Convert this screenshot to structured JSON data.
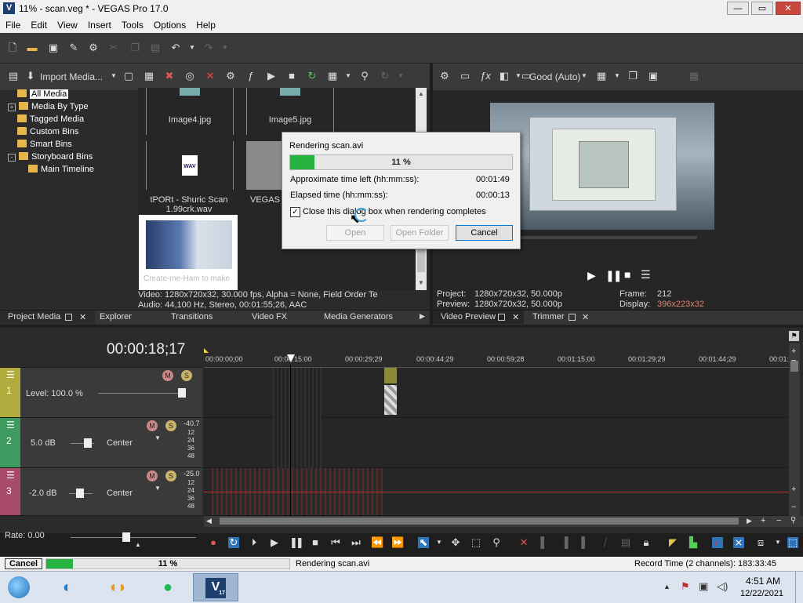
{
  "window": {
    "title": "11% - scan.veg * - VEGAS Pro 17.0",
    "logo": "V",
    "min": "—",
    "max": "▭",
    "close": "✕"
  },
  "menu": [
    "File",
    "Edit",
    "View",
    "Insert",
    "Tools",
    "Options",
    "Help"
  ],
  "media_panel": {
    "import_label": "Import Media...",
    "tree": [
      {
        "label": "All Media",
        "expander": "",
        "selected": true
      },
      {
        "label": "Media By Type",
        "expander": "+"
      },
      {
        "label": "Tagged Media",
        "expander": ""
      },
      {
        "label": "Custom Bins",
        "expander": ""
      },
      {
        "label": "Smart Bins",
        "expander": ""
      },
      {
        "label": "Storyboard Bins",
        "expander": "-"
      },
      {
        "label": "Main Timeline",
        "expander": "",
        "indent": true
      }
    ],
    "thumbs": {
      "image4": "Image4.jpg",
      "image5": "Image5.jpg",
      "wav_line1": "tPORt - Shuric Scan",
      "wav_line2": "1.99crk.wav",
      "wav_icon": "WAV",
      "vegas_s": "VEGAS S",
      "video_caption": "Create-me-Ham to make"
    },
    "info_line1": "Video: 1280x720x32, 30.000 fps, Alpha = None, Field Order Te",
    "info_line2": "Audio: 44,100 Hz, Stereo, 00:01:55;26, AAC"
  },
  "bottom_tabs": {
    "project_media": "Project Media",
    "explorer": "Explorer",
    "transitions": "Transitions",
    "video_fx": "Video FX",
    "media_generators": "Media Generators",
    "video_preview": "Video Preview",
    "trimmer": "Trimmer",
    "close_x": "✕",
    "more": "▶"
  },
  "preview": {
    "quality": "Good (Auto)",
    "project_label": "Project:",
    "project_value": "1280x720x32, 50.000p",
    "preview_label": "Preview:",
    "preview_value": "1280x720x32, 50.000p",
    "frame_label": "Frame:",
    "frame_value": "212",
    "display_label": "Display:",
    "display_value": "396x223x32"
  },
  "dialog": {
    "title": "Rendering scan.avi",
    "progress_pct": 11,
    "progress_label": "11 %",
    "time_left_label": "Approximate time left (hh:mm:ss):",
    "time_left": "00:01:49",
    "elapsed_label": "Elapsed time (hh:mm:ss):",
    "elapsed": "00:00:13",
    "close_checkbox": "Close this dialog box when rendering completes",
    "open": "Open",
    "open_folder": "Open Folder",
    "cancel": "Cancel"
  },
  "timeline": {
    "timecode": "00:00:18;17",
    "ruler": [
      "00:00:00;00",
      "00:00:15:00",
      "00:00:29;29",
      "00:00:44;29",
      "00:00:59;28",
      "00:01:15;00",
      "00:01:29;29",
      "00:01:44;29",
      "00:01:"
    ],
    "tracks": [
      {
        "num": "1",
        "label": "Level: 100.0 %",
        "color": "#b0ad3e"
      },
      {
        "num": "2",
        "label": "5.0 dB",
        "pan": "Center",
        "peak": "-40.7",
        "color": "#3f9a5f"
      },
      {
        "num": "3",
        "label": "-2.0 dB",
        "pan": "Center",
        "peak": "-25.0",
        "color": "#a84a6a"
      }
    ],
    "meter_ticks": [
      "12",
      "24",
      "36",
      "48"
    ],
    "rate": "Rate: 0.00"
  },
  "status": {
    "cancel": "Cancel",
    "progress_pct": 11,
    "progress_label": "11 %",
    "message": "Rendering scan.avi",
    "record_time": "Record Time (2 channels): 183:33:45"
  },
  "taskbar": {
    "time": "4:51 AM",
    "date": "12/22/2021",
    "vegas_badge": "17"
  },
  "colors": {
    "accent": "#0078d7",
    "progress": "#26b341",
    "display_value": "#e08070"
  }
}
